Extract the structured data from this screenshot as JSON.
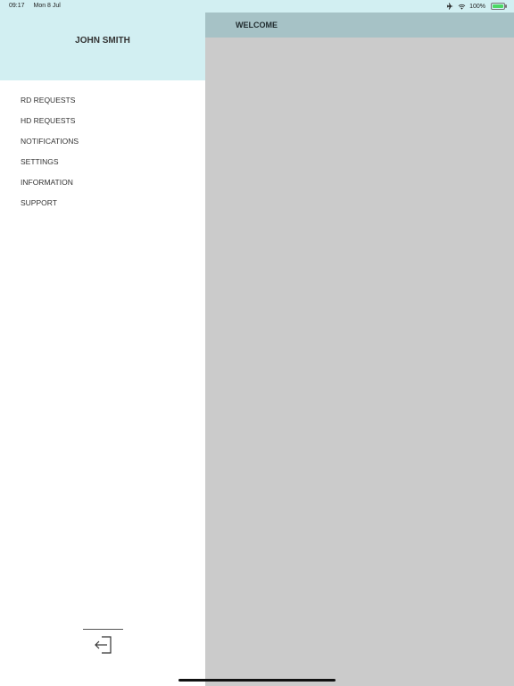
{
  "status": {
    "time": "09:17",
    "date": "Mon 8 Jul",
    "battery_text": "100%"
  },
  "drawer": {
    "user_name": "JOHN SMITH",
    "menu_items": [
      {
        "label": "RD REQUESTS"
      },
      {
        "label": "HD REQUESTS"
      },
      {
        "label": "NOTIFICATIONS"
      },
      {
        "label": "SETTINGS"
      },
      {
        "label": "INFORMATION"
      },
      {
        "label": "SUPPORT"
      }
    ]
  },
  "main": {
    "title": "WELCOME"
  },
  "colors": {
    "header_bg": "#d2eff2",
    "topbar_bg": "#a6c2c6",
    "content_bg": "#cbcbcb"
  },
  "icons": {
    "logout": "logout-icon",
    "airplane": "airplane-icon",
    "wifi": "wifi-icon",
    "battery": "battery-icon"
  }
}
